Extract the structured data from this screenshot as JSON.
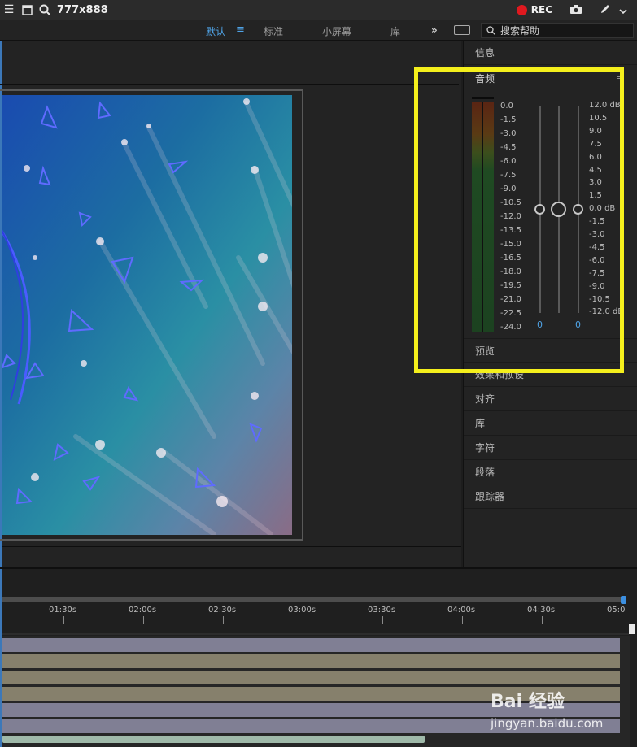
{
  "capture_bar": {
    "dimensions": "777x888",
    "rec_label": "REC",
    "rec_color": "#e0191f"
  },
  "workspace": {
    "items": [
      "默认",
      "标准",
      "小屏幕",
      "库"
    ],
    "active_index": 0,
    "overflow_glyph": "»",
    "search_placeholder": "搜索帮助"
  },
  "right_panel": {
    "info_label": "信息",
    "audio": {
      "title": "音频",
      "meter_scale": [
        "0.0",
        "-1.5",
        "-3.0",
        "-4.5",
        "-6.0",
        "-7.5",
        "-9.0",
        "-10.5",
        "-12.0",
        "-13.5",
        "-15.0",
        "-16.5",
        "-18.0",
        "-19.5",
        "-21.0",
        "-22.5",
        "-24.0"
      ],
      "gain_scale": [
        "12.0 dB",
        "10.5",
        "9.0",
        "7.5",
        "6.0",
        "4.5",
        "3.0",
        "1.5",
        "0.0 dB",
        "-1.5",
        "-3.0",
        "-4.5",
        "-6.0",
        "-7.5",
        "-9.0",
        "-10.5",
        "-12.0 dB"
      ],
      "left_channel_value": "0",
      "right_channel_value": "0"
    },
    "panels": [
      "预览",
      "效果和预设",
      "对齐",
      "库",
      "字符",
      "段落",
      "跟踪器"
    ]
  },
  "timeline": {
    "time_labels": [
      "01:30s",
      "02:00s",
      "02:30s",
      "03:00s",
      "03:30s",
      "04:00s",
      "04:30s",
      "05:0"
    ]
  },
  "watermark": {
    "logo_text": "Bai 经验",
    "url_text": "jingyan.baidu.com"
  },
  "colors": {
    "highlight_box": "#f4ef1c",
    "accent_blue": "#4fa3e6"
  }
}
